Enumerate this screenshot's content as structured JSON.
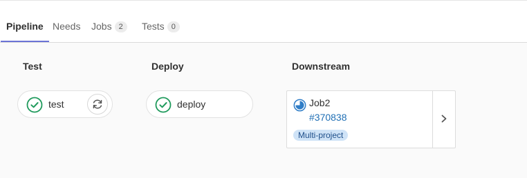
{
  "tabs": {
    "pipeline": "Pipeline",
    "needs": "Needs",
    "jobs": {
      "label": "Jobs",
      "count": "2"
    },
    "tests": {
      "label": "Tests",
      "count": "0"
    },
    "active": "pipeline"
  },
  "stages": {
    "test": {
      "title": "Test",
      "job": {
        "name": "test",
        "status": "passed",
        "status_icon": "check-circle-icon",
        "action_icon": "retry-icon"
      }
    },
    "deploy": {
      "title": "Deploy",
      "job": {
        "name": "deploy",
        "status": "passed",
        "status_icon": "check-circle-icon"
      }
    },
    "downstream": {
      "title": "Downstream",
      "card": {
        "name": "Job2",
        "pipeline_id": "#370838",
        "tag": "Multi-project",
        "status": "running",
        "status_icon": "running-status-icon",
        "expand_icon": "chevron-right-icon"
      }
    }
  },
  "colors": {
    "success": "#1f9a5c",
    "running": "#2f7dc7",
    "link": "#1f6fb5",
    "active_tab_underline": "#6b73d6",
    "tag_background": "#cfe3f7"
  }
}
